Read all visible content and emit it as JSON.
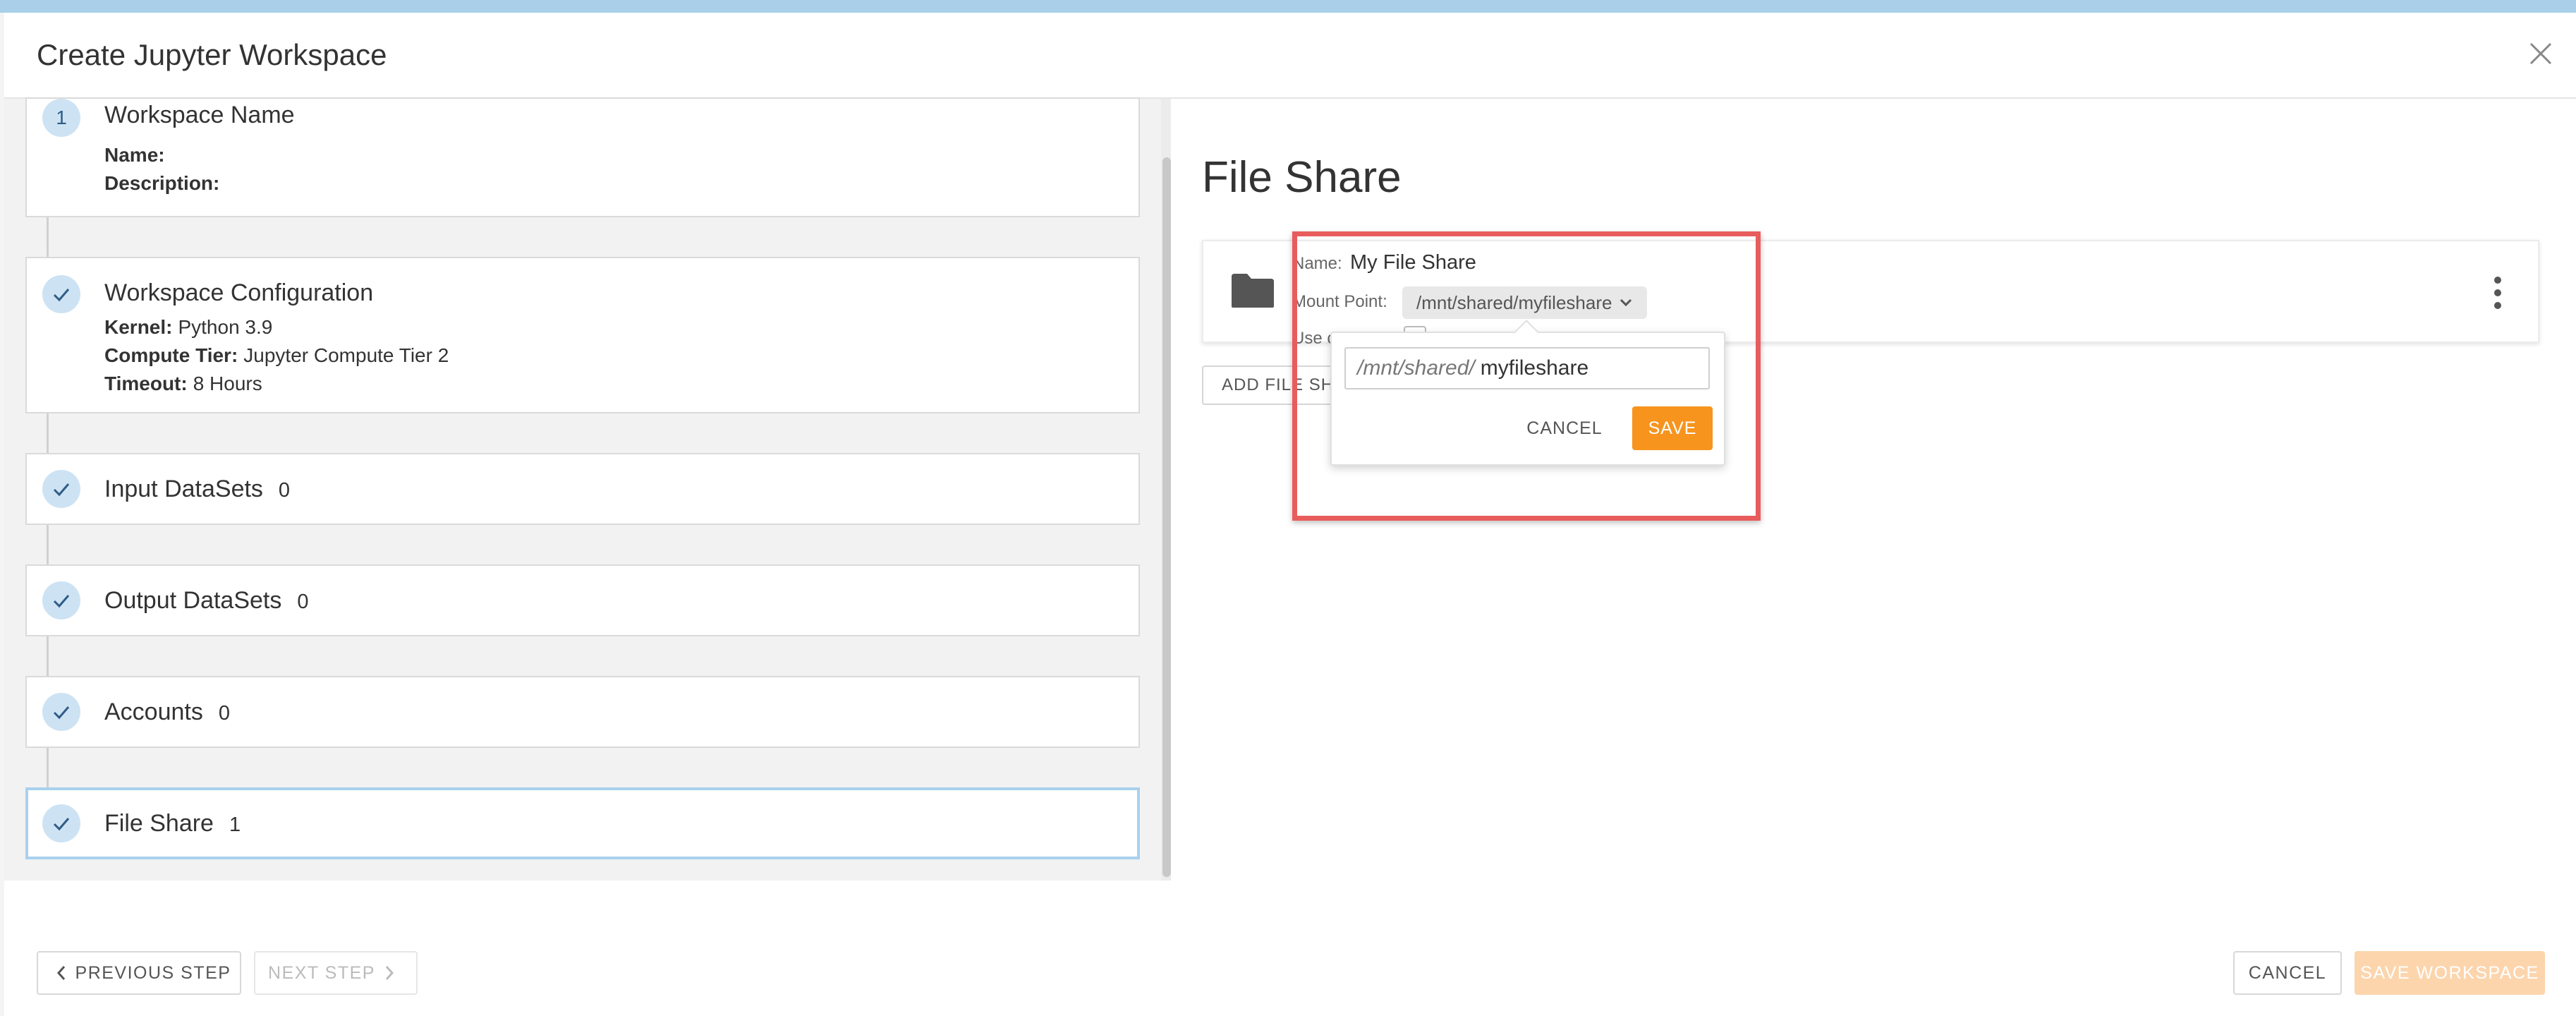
{
  "modal": {
    "title": "Create Jupyter Workspace"
  },
  "steps": [
    {
      "number": "1",
      "title": "Workspace Name",
      "details": [
        {
          "label": "Name:",
          "value": ""
        },
        {
          "label": "Description:",
          "value": ""
        }
      ]
    },
    {
      "title": "Workspace Configuration",
      "details": [
        {
          "label": "Kernel:",
          "value": "Python 3.9"
        },
        {
          "label": "Compute Tier:",
          "value": "Jupyter Compute Tier 2"
        },
        {
          "label": "Timeout:",
          "value": "8 Hours"
        }
      ]
    },
    {
      "title": "Input DataSets",
      "count": "0"
    },
    {
      "title": "Output DataSets",
      "count": "0"
    },
    {
      "title": "Accounts",
      "count": "0"
    },
    {
      "title": "File Share",
      "count": "1",
      "active": true
    }
  ],
  "content": {
    "title": "File Share",
    "file_share": {
      "name_label": "Name:",
      "name_value": "My File Share",
      "mount_label": "Mount Point:",
      "mount_value": "/mnt/shared/myfileshare",
      "use_label": "Use c"
    },
    "add_button": "ADD FILE SHARE"
  },
  "popover": {
    "prefix": "/mnt/shared/",
    "value": "myfileshare",
    "cancel": "CANCEL",
    "save": "SAVE"
  },
  "footer": {
    "previous": "PREVIOUS STEP",
    "next": "NEXT STEP",
    "cancel": "CANCEL",
    "save_workspace": "SAVE WORKSPACE"
  },
  "colors": {
    "accent": "#f7941e",
    "step_circle": "#cde3f4",
    "highlight": "#e85c5c",
    "active_border": "#a9d1ee"
  },
  "icons": [
    "close-icon",
    "check-icon",
    "folder-icon",
    "kebab-icon",
    "chevron-down-icon",
    "chevron-left-icon",
    "chevron-right-icon"
  ]
}
